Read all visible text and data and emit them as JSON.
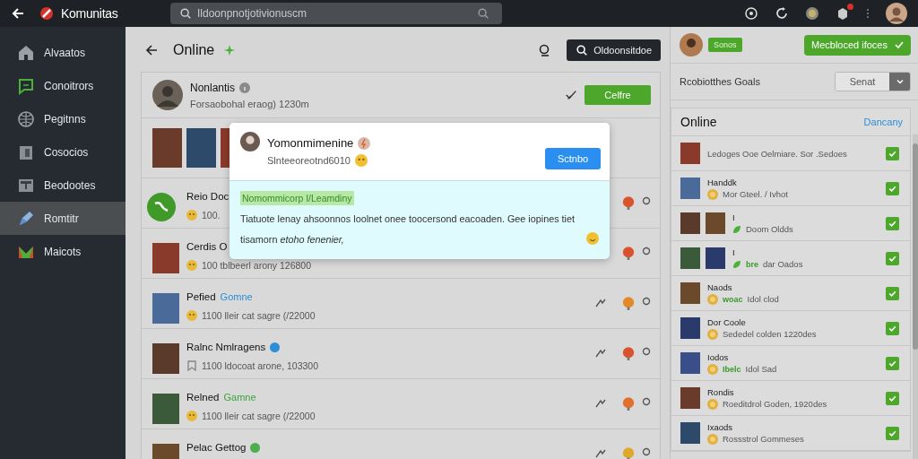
{
  "top_bar": {
    "title": "Komunitas",
    "search": {
      "placeholder": "Ildoonpnotjotivionuscm"
    }
  },
  "sidebar": {
    "items": [
      {
        "label": "Alvaatos",
        "selected": false
      },
      {
        "label": "Conoitrors",
        "selected": false
      },
      {
        "label": "Pegitnns",
        "selected": false
      },
      {
        "label": "Cosocios",
        "selected": false
      },
      {
        "label": "Beodootes",
        "selected": false
      },
      {
        "label": "Romtitr",
        "selected": true
      },
      {
        "label": "Maicots",
        "selected": false
      }
    ]
  },
  "feed": {
    "title": "Online",
    "search_button": "Oldoonsitdoe",
    "items": [
      {
        "kind": "profile",
        "name": "Nonlantis",
        "meta": "Forsaobohal eraog) 1230m",
        "button": "Celfre"
      },
      {
        "kind": "gallery"
      },
      {
        "kind": "post",
        "avatar": {
          "kind": "logo"
        },
        "name": "Reio Doc",
        "meta": "100.",
        "meta_icon": {
          "kind": "emoji"
        },
        "pin": {
          "color": "#d9532b"
        }
      },
      {
        "kind": "post",
        "avatar": {
          "kind": "photo"
        },
        "name": "Cerdis O",
        "meta": "100 tblbeerl arony 126800",
        "meta_icon": {
          "kind": "emoji"
        },
        "pin": {
          "color": "#d9532b"
        }
      },
      {
        "kind": "post",
        "avatar": {
          "kind": "photo"
        },
        "name": "Pefied",
        "tag": {
          "text": "Gomne",
          "color": "#2a8fd8"
        },
        "meta": "1100 lleir cat sagre (/22000",
        "meta_icon": {
          "kind": "emoji"
        },
        "pin": {
          "color": "#e08a2a"
        }
      },
      {
        "kind": "post",
        "avatar": {
          "kind": "photo"
        },
        "name": "Ralnc  Nmlragens",
        "badge": {
          "color": "#2a8fd8"
        },
        "meta": "1100 ldocoat arone, 103300",
        "meta_icon": {
          "kind": "bookmark"
        },
        "pin": {
          "color": "#d9532b"
        }
      },
      {
        "kind": "post",
        "avatar": {
          "kind": "photo"
        },
        "name": "Relned",
        "tag": {
          "text": "Gamne",
          "color": "#3aa63a"
        },
        "meta": "1100 lleir cat sagre (/22000",
        "meta_icon": {
          "kind": "emoji"
        },
        "pin": {
          "color": "#e0702a"
        }
      },
      {
        "kind": "post",
        "avatar": {
          "kind": "photo"
        },
        "name": "Pelac Gettog",
        "badge": {
          "color": "#4cae4c"
        },
        "pin": {
          "color": "#e0a82a"
        }
      }
    ]
  },
  "popup": {
    "name": "Yomonmimenine",
    "meta": "Slnteeoreotnd6010",
    "button": "Sctnbo",
    "tag": "Nomommicorp I/Leamdiny",
    "text": "Tiatuote lenay ahsoonnos loolnet onee toocersond eacoaden. Gee  iopines tiet tisamorn *etoho fenenier,*"
  },
  "right_panel": {
    "badge": "Sonos",
    "action_button": "Mecbloced ifoces",
    "filter_label": "Rcobiotthes Goals",
    "filter_select": "Senat",
    "list_title": "Online",
    "list_link": "Dancany",
    "items": [
      {
        "kind": "single",
        "text": "Ledoges Ooe Oelmiare. Sor .Sedoes",
        "checked": true
      },
      {
        "kind": "single",
        "name": "Handdk",
        "meta_icon": {
          "kind": "emoji"
        },
        "text": "Mor Gteel. / Ivhot",
        "checked": true
      },
      {
        "kind": "pair",
        "name": "I",
        "meta_icon": {
          "kind": "leaf"
        },
        "text": "Doom Oldds",
        "checked": true
      },
      {
        "kind": "pair",
        "name": "I",
        "meta_icon": {
          "kind": "leaf"
        },
        "tag": "bre",
        "text": "dar Oados",
        "checked": true
      },
      {
        "kind": "single",
        "name": "Naods",
        "meta_icon": {
          "kind": "emoji"
        },
        "tag": "woac",
        "text": "Idol clod",
        "checked": true
      },
      {
        "kind": "single",
        "name": "Dor Coole",
        "meta_icon": {
          "kind": "emoji"
        },
        "text": "Sededel colden 1220des",
        "checked": true
      },
      {
        "kind": "single",
        "name": "Iodos",
        "meta_icon": {
          "kind": "emoji"
        },
        "tag": "Ibelc",
        "text": "Idol Sad",
        "checked": true
      },
      {
        "kind": "single",
        "name": "Rondis",
        "meta_icon": {
          "kind": "emoji"
        },
        "text": "Roeditdrol Goden, 1920des",
        "checked": true
      },
      {
        "kind": "single",
        "name": "Ixaods",
        "meta_icon": {
          "kind": "emoji"
        },
        "text": "Rossstrol Gommeses",
        "checked": true
      }
    ]
  }
}
